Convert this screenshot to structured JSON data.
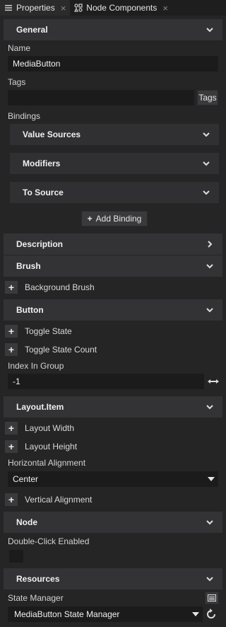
{
  "tabs": [
    {
      "label": "Properties",
      "icon": "list-icon",
      "active": true
    },
    {
      "label": "Node Components",
      "icon": "components-icon",
      "active": false
    }
  ],
  "close_glyph": "×",
  "sections": {
    "general": "General",
    "value_sources": "Value Sources",
    "modifiers": "Modifiers",
    "to_source": "To Source",
    "description": "Description",
    "brush": "Brush",
    "button": "Button",
    "layout_item": "Layout.Item",
    "node": "Node",
    "resources": "Resources"
  },
  "labels": {
    "name": "Name",
    "tags": "Tags",
    "bindings": "Bindings",
    "index_in_group": "Index In Group",
    "horizontal_alignment": "Horizontal Alignment",
    "double_click_enabled": "Double-Click Enabled",
    "state_manager": "State Manager"
  },
  "values": {
    "name": "MediaButton",
    "tags": "",
    "index_in_group": "-1",
    "horizontal_alignment": "Center",
    "state_manager": "MediaButton State Manager"
  },
  "buttons": {
    "tags": "Tags",
    "add_binding": "Add Binding",
    "add_binding_glyph": "+"
  },
  "add_properties": {
    "background_brush": "Background Brush",
    "toggle_state": "Toggle State",
    "toggle_state_count": "Toggle State Count",
    "layout_width": "Layout Width",
    "layout_height": "Layout Height",
    "vertical_alignment": "Vertical Alignment"
  },
  "plus_glyph": "+",
  "colors": {
    "background": "#252526",
    "section_header": "#333336",
    "input": "#1b1b1b",
    "text": "#d8d8d8"
  }
}
